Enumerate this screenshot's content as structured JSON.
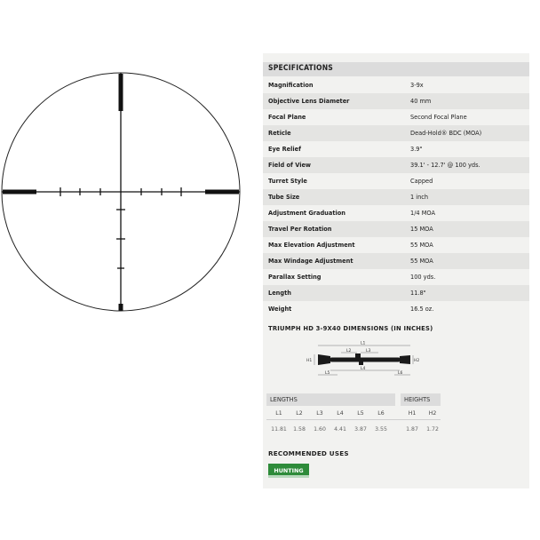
{
  "specifications": {
    "title": "SPECIFICATIONS",
    "rows": [
      {
        "label": "Magnification",
        "value": "3-9x"
      },
      {
        "label": "Objective Lens Diameter",
        "value": "40 mm"
      },
      {
        "label": "Focal Plane",
        "value": "Second Focal Plane"
      },
      {
        "label": "Reticle",
        "value": "Dead-Hold® BDC (MOA)"
      },
      {
        "label": "Eye Relief",
        "value": "3.9\""
      },
      {
        "label": "Field of View",
        "value": "39.1' - 12.7' @ 100 yds."
      },
      {
        "label": "Turret Style",
        "value": "Capped"
      },
      {
        "label": "Tube Size",
        "value": "1 inch"
      },
      {
        "label": "Adjustment Graduation",
        "value": "1/4 MOA"
      },
      {
        "label": "Travel Per Rotation",
        "value": "15 MOA"
      },
      {
        "label": "Max Elevation Adjustment",
        "value": "55 MOA"
      },
      {
        "label": "Max Windage Adjustment",
        "value": "55 MOA"
      },
      {
        "label": "Parallax Setting",
        "value": "100 yds."
      },
      {
        "label": "Length",
        "value": "11.8\""
      },
      {
        "label": "Weight",
        "value": "16.5 oz."
      }
    ]
  },
  "dimensions": {
    "title": "TRIUMPH HD 3-9X40 DIMENSIONS (IN INCHES)",
    "diagram_labels": {
      "L1": "L1",
      "L2": "L2",
      "L3": "L3",
      "L4": "L4",
      "L5": "L5",
      "L6": "L6",
      "H1": "H1",
      "H2": "H2"
    },
    "lengths": {
      "heading": "LENGTHS",
      "columns": [
        "L1",
        "L2",
        "L3",
        "L4",
        "L5",
        "L6"
      ],
      "values": [
        "11.81",
        "1.58",
        "1.60",
        "4.41",
        "3.87",
        "3.55"
      ]
    },
    "heights": {
      "heading": "HEIGHTS",
      "columns": [
        "H1",
        "H2"
      ],
      "values": [
        "1.87",
        "1.72"
      ]
    }
  },
  "recommended": {
    "title": "RECOMMENDED USES",
    "badge": "HUNTING",
    "badge_color": "#2e8b3a"
  }
}
